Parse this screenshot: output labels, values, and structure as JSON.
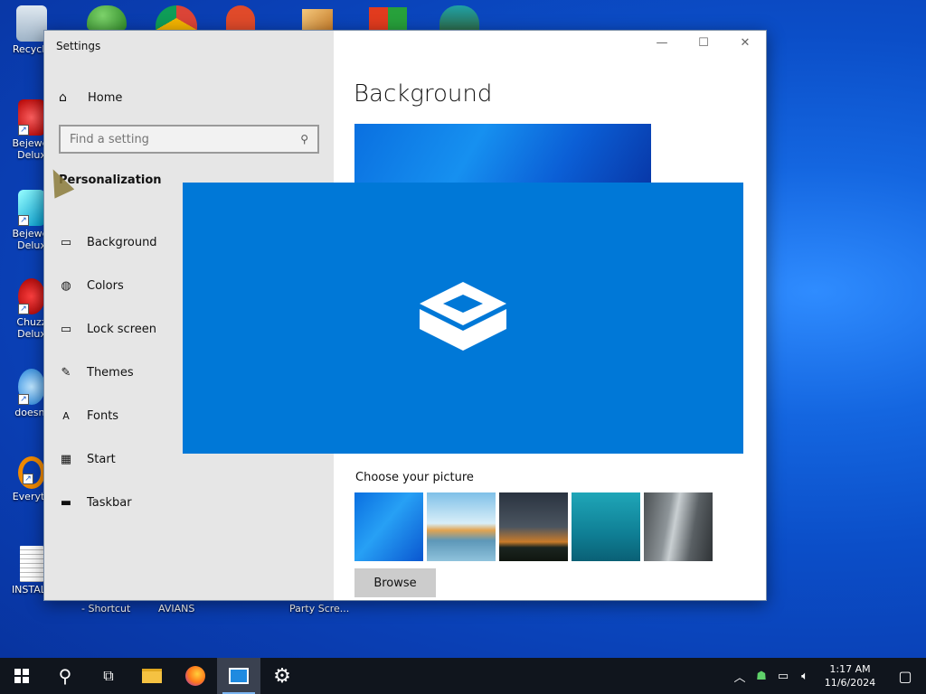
{
  "desktop": {
    "icons": [
      {
        "label": "Recycle",
        "icon": "recycle-bin-icon"
      },
      {
        "label": "Bejewel\nDelux",
        "icon": "bejeweled-icon"
      },
      {
        "label": "Bejewel\nDelux",
        "icon": "bejeweled-diamond-icon"
      },
      {
        "label": "Chuzz\nDelux",
        "icon": "chuzzle-icon"
      },
      {
        "label": "doesnt",
        "icon": "app-icon"
      },
      {
        "label": "Everyth",
        "icon": "everything-search-icon"
      },
      {
        "label": "INSTALL",
        "icon": "document-icon"
      }
    ],
    "bottom_labels": [
      "- Shortcut",
      "AVIANS",
      "Party Scre..."
    ]
  },
  "window": {
    "title": "Settings",
    "controls": {
      "minimize": "—",
      "maximize": "☐",
      "close": "✕"
    }
  },
  "sidebar": {
    "home_label": "Home",
    "search_placeholder": "Find a setting",
    "section_title": "Personalization",
    "items": [
      {
        "label": "Background",
        "icon": "image-icon"
      },
      {
        "label": "Colors",
        "icon": "palette-icon"
      },
      {
        "label": "Lock screen",
        "icon": "lock-screen-icon"
      },
      {
        "label": "Themes",
        "icon": "brush-icon"
      },
      {
        "label": "Fonts",
        "icon": "font-icon"
      },
      {
        "label": "Start",
        "icon": "start-icon"
      },
      {
        "label": "Taskbar",
        "icon": "taskbar-icon"
      }
    ]
  },
  "content": {
    "page_title": "Background",
    "choose_label": "Choose your picture",
    "browse_label": "Browse"
  },
  "taskbar": {
    "clock_time": "1:17 AM",
    "clock_date": "11/6/2024"
  }
}
